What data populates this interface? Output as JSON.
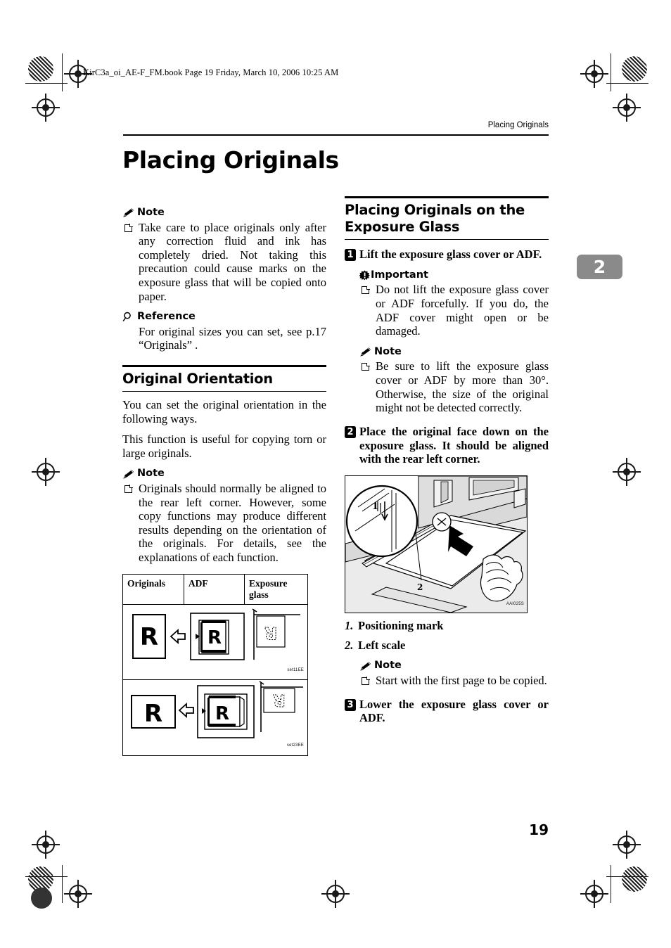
{
  "document": {
    "file_header": "KirC3a_oi_AE-F_FM.book  Page 19  Friday, March 10, 2006  10:25 AM",
    "running_header": "Placing Originals",
    "page_title": "Placing Originals",
    "chapter_tab": "2",
    "page_number": "19"
  },
  "left_column": {
    "note_label": "Note",
    "note_text": "Take care to place originals only after any correction fluid and ink has completely dried. Not taking this precaution could cause marks on the exposure glass that will be copied onto paper.",
    "reference_label": "Reference",
    "reference_text": "For original sizes you can set, see p.17 “Originals” .",
    "section_heading": "Original Orientation",
    "para_1": "You can set the original orientation in the following ways.",
    "para_2": "This function is useful for copying torn or large originals.",
    "note2_label": "Note",
    "note2_text": "Originals should normally be aligned to the rear left corner. However, some copy functions may produce different results depending on the orientation of the originals. For details, see the explanations of each function.",
    "table": {
      "headers": [
        "Originals",
        "ADF",
        "Exposure glass"
      ],
      "rows": [
        {
          "original_letter": "R",
          "orientation": "portrait",
          "caption": "set11EE"
        },
        {
          "original_letter": "R",
          "orientation": "landscape",
          "caption": "set23EE"
        }
      ]
    }
  },
  "right_column": {
    "section_heading": "Placing Originals on the Exposure Glass",
    "step1": {
      "number": "1",
      "text": "Lift the exposure glass cover or ADF.",
      "important_label": "Important",
      "important_text": "Do not lift the exposure glass cover or ADF forcefully. If you do, the ADF cover might open or be damaged.",
      "note_label": "Note",
      "note_text": "Be sure to lift the exposure glass cover or ADF by more than 30°. Otherwise, the size of the original might not be detected correctly."
    },
    "step2": {
      "number": "2",
      "text": "Place the original face down on the exposure glass. It should be aligned with the rear left corner.",
      "illustration_caption": "AAI025S",
      "illustration_callouts": [
        "1",
        "2"
      ],
      "legend": [
        {
          "num": "1.",
          "label": "Positioning mark"
        },
        {
          "num": "2.",
          "label": "Left scale"
        }
      ],
      "note_label": "Note",
      "note_text": "Start with the first page to be copied."
    },
    "step3": {
      "number": "3",
      "text": "Lower the exposure glass cover or ADF."
    }
  },
  "colors": {
    "ink": "#000000",
    "paper": "#ffffff",
    "chapter_tab_bg": "#8a8a8a",
    "illustration_gray": "#d7d7d7"
  }
}
